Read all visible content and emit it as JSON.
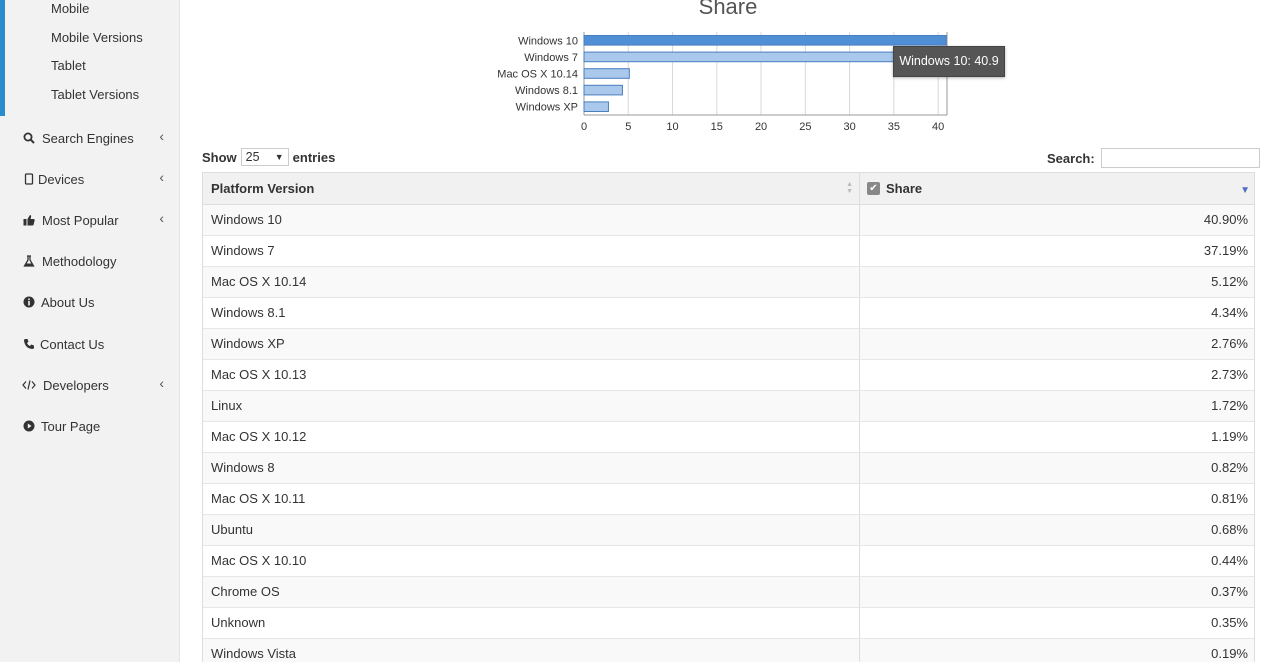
{
  "sidebar": {
    "sub_items": [
      "Mobile",
      "Mobile Versions",
      "Tablet",
      "Tablet Versions"
    ],
    "nav": [
      {
        "label": "Search Engines",
        "icon": "search-icon",
        "chevron": true
      },
      {
        "label": "Devices",
        "icon": "device-icon",
        "chevron": true
      },
      {
        "label": "Most Popular",
        "icon": "thumbs-up-icon",
        "chevron": true
      },
      {
        "label": "Methodology",
        "icon": "flask-icon",
        "chevron": false
      },
      {
        "label": "About Us",
        "icon": "info-icon",
        "chevron": false
      },
      {
        "label": "Contact Us",
        "icon": "phone-icon",
        "chevron": false
      },
      {
        "label": "Developers",
        "icon": "code-icon",
        "chevron": true
      },
      {
        "label": "Tour Page",
        "icon": "play-circle-icon",
        "chevron": false
      }
    ],
    "chevron_glyph": "‹",
    "accent_color": "#2b8ccd"
  },
  "chart_data": {
    "type": "bar",
    "orientation": "horizontal",
    "title": "Share",
    "categories": [
      "Windows 10",
      "Windows 7",
      "Mac OS X 10.14",
      "Windows 8.1",
      "Windows XP"
    ],
    "values": [
      40.9,
      37.19,
      5.12,
      4.34,
      2.76
    ],
    "xlim": [
      0,
      41
    ],
    "xticks": [
      "0",
      "5",
      "10",
      "15",
      "20",
      "25",
      "30",
      "35",
      "40"
    ],
    "grid": true,
    "highlight_index": 0,
    "colors": {
      "bar": "#a9c8ec",
      "bar_highlight": "#4f8fd6",
      "bar_stroke": "#4a7ec0",
      "grid": "#d8d8d8"
    },
    "tooltip": "Windows 10: 40.9"
  },
  "table": {
    "show_label": "Show",
    "length_value": "25",
    "entries_label": "entries",
    "search_label": "Search:",
    "headers": [
      "Platform Version",
      "Share"
    ],
    "rows": [
      [
        "Windows 10",
        "40.90%"
      ],
      [
        "Windows 7",
        "37.19%"
      ],
      [
        "Mac OS X 10.14",
        "5.12%"
      ],
      [
        "Windows 8.1",
        "4.34%"
      ],
      [
        "Windows XP",
        "2.76%"
      ],
      [
        "Mac OS X 10.13",
        "2.73%"
      ],
      [
        "Linux",
        "1.72%"
      ],
      [
        "Mac OS X 10.12",
        "1.19%"
      ],
      [
        "Windows 8",
        "0.82%"
      ],
      [
        "Mac OS X 10.11",
        "0.81%"
      ],
      [
        "Ubuntu",
        "0.68%"
      ],
      [
        "Mac OS X 10.10",
        "0.44%"
      ],
      [
        "Chrome OS",
        "0.37%"
      ],
      [
        "Unknown",
        "0.35%"
      ],
      [
        "Windows Vista",
        "0.19%"
      ]
    ]
  }
}
